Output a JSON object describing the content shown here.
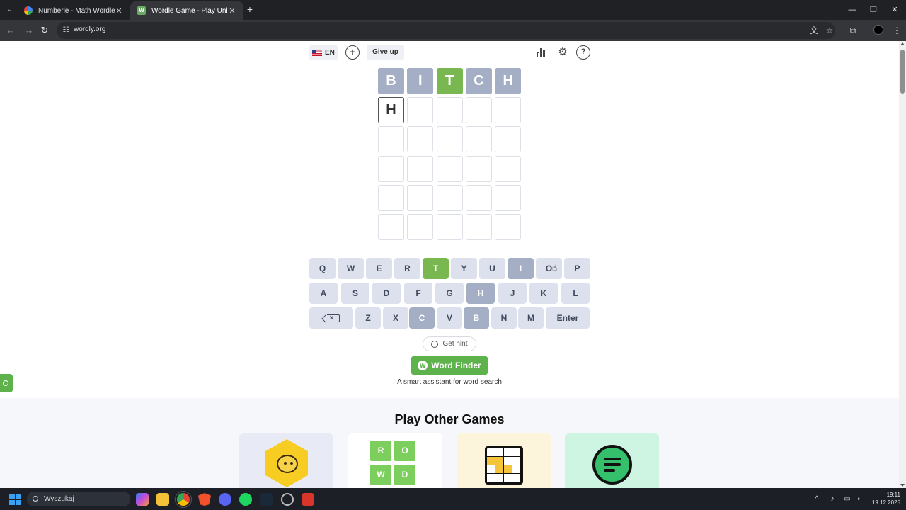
{
  "browser": {
    "tabs": [
      {
        "title": "Numberle - Math Wordle Game",
        "active": false
      },
      {
        "title": "Wordle Game - Play Unlimited",
        "active": true
      }
    ],
    "new_tab_label": "+",
    "url": "wordly.org"
  },
  "header": {
    "language": "EN",
    "give_up_label": "Give up",
    "add_icon": "plus-circle-icon",
    "icons": [
      "stats-icon",
      "gear-icon",
      "help-icon"
    ]
  },
  "board": {
    "rows": [
      [
        {
          "letter": "B",
          "state": "absent"
        },
        {
          "letter": "I",
          "state": "absent"
        },
        {
          "letter": "T",
          "state": "correct"
        },
        {
          "letter": "C",
          "state": "absent"
        },
        {
          "letter": "H",
          "state": "absent"
        }
      ],
      [
        {
          "letter": "H",
          "state": "filled"
        },
        {
          "letter": "",
          "state": "empty"
        },
        {
          "letter": "",
          "state": "empty"
        },
        {
          "letter": "",
          "state": "empty"
        },
        {
          "letter": "",
          "state": "empty"
        }
      ],
      [
        {
          "letter": "",
          "state": "empty"
        },
        {
          "letter": "",
          "state": "empty"
        },
        {
          "letter": "",
          "state": "empty"
        },
        {
          "letter": "",
          "state": "empty"
        },
        {
          "letter": "",
          "state": "empty"
        }
      ],
      [
        {
          "letter": "",
          "state": "empty"
        },
        {
          "letter": "",
          "state": "empty"
        },
        {
          "letter": "",
          "state": "empty"
        },
        {
          "letter": "",
          "state": "empty"
        },
        {
          "letter": "",
          "state": "empty"
        }
      ],
      [
        {
          "letter": "",
          "state": "empty"
        },
        {
          "letter": "",
          "state": "empty"
        },
        {
          "letter": "",
          "state": "empty"
        },
        {
          "letter": "",
          "state": "empty"
        },
        {
          "letter": "",
          "state": "empty"
        }
      ],
      [
        {
          "letter": "",
          "state": "empty"
        },
        {
          "letter": "",
          "state": "empty"
        },
        {
          "letter": "",
          "state": "empty"
        },
        {
          "letter": "",
          "state": "empty"
        },
        {
          "letter": "",
          "state": "empty"
        }
      ]
    ],
    "colors": {
      "absent": "#a4aec4",
      "correct": "#79b851",
      "key": "#dce1ed"
    }
  },
  "keyboard": {
    "row1": [
      {
        "label": "Q",
        "state": "default"
      },
      {
        "label": "W",
        "state": "default"
      },
      {
        "label": "E",
        "state": "default"
      },
      {
        "label": "R",
        "state": "default"
      },
      {
        "label": "T",
        "state": "correct"
      },
      {
        "label": "Y",
        "state": "default"
      },
      {
        "label": "U",
        "state": "default"
      },
      {
        "label": "I",
        "state": "absent"
      },
      {
        "label": "O",
        "state": "default"
      },
      {
        "label": "P",
        "state": "default"
      }
    ],
    "row2": [
      {
        "label": "A",
        "state": "default"
      },
      {
        "label": "S",
        "state": "default"
      },
      {
        "label": "D",
        "state": "default"
      },
      {
        "label": "F",
        "state": "default"
      },
      {
        "label": "G",
        "state": "default"
      },
      {
        "label": "H",
        "state": "absent"
      },
      {
        "label": "J",
        "state": "default"
      },
      {
        "label": "K",
        "state": "default"
      },
      {
        "label": "L",
        "state": "default"
      }
    ],
    "row3": [
      {
        "label": "",
        "state": "default",
        "icon": "backspace-icon"
      },
      {
        "label": "Z",
        "state": "default"
      },
      {
        "label": "X",
        "state": "default"
      },
      {
        "label": "C",
        "state": "absent"
      },
      {
        "label": "V",
        "state": "default"
      },
      {
        "label": "B",
        "state": "absent"
      },
      {
        "label": "N",
        "state": "default"
      },
      {
        "label": "M",
        "state": "default"
      },
      {
        "label": "Enter",
        "state": "default"
      }
    ]
  },
  "hint_label": "Get hint",
  "word_finder": {
    "label": "Word Finder",
    "logo": "W",
    "subtitle": "A smart assistant for word search"
  },
  "other_games": {
    "title": "Play Other Games",
    "cards": [
      {
        "icon": "bee-icon"
      },
      {
        "icon": "word-tiles-icon",
        "letters": [
          "R",
          "O",
          "W",
          "D"
        ]
      },
      {
        "icon": "grid-icon"
      },
      {
        "icon": "chat-icon"
      }
    ]
  },
  "taskbar": {
    "search_label": "Wyszukaj",
    "time": "19:11",
    "date": "19.12.2025"
  }
}
